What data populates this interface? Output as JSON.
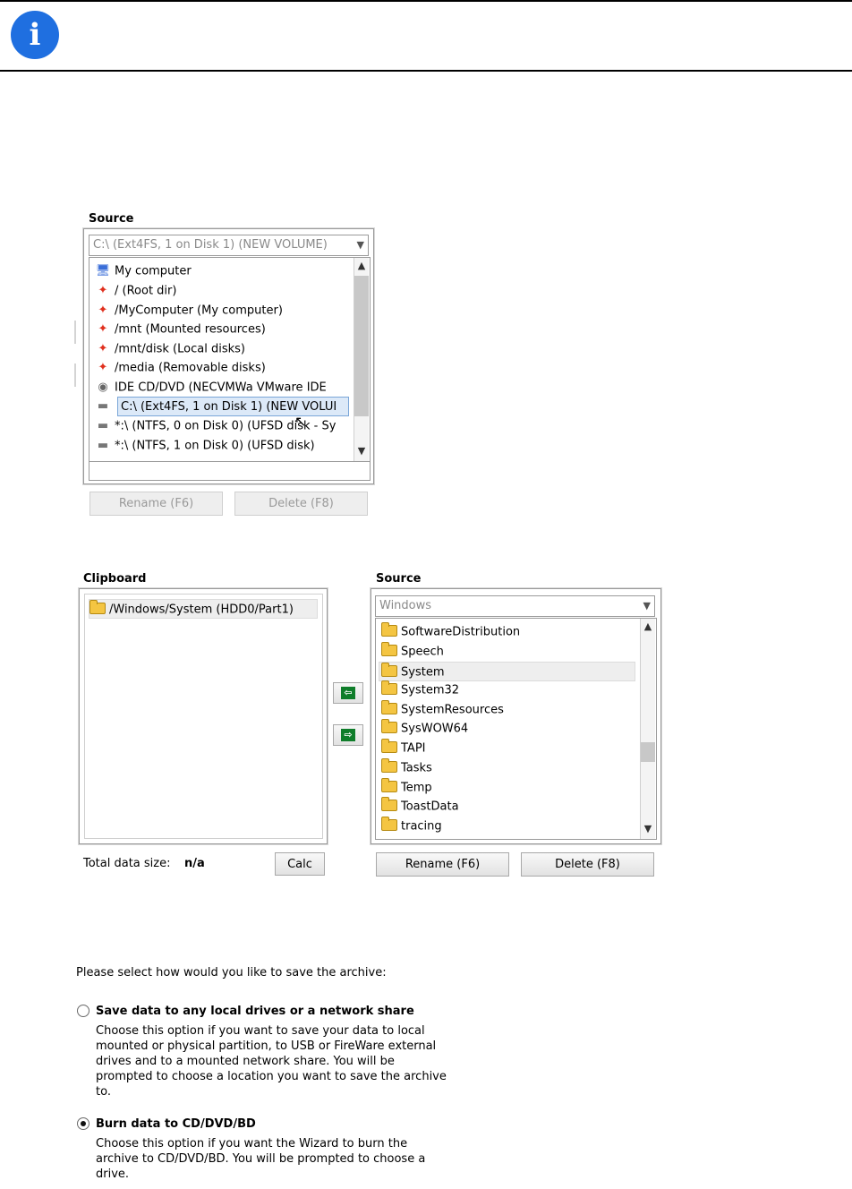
{
  "top": {
    "info_icon": "info-icon"
  },
  "source_panel_1": {
    "label": "Source",
    "combo_value": "C:\\  (Ext4FS, 1 on Disk 1) (NEW VOLUME)",
    "items": [
      {
        "icon": "computer-icon",
        "text": "My computer"
      },
      {
        "icon": "linux-icon",
        "text": "/ (Root dir)"
      },
      {
        "icon": "linux-icon",
        "text": "/MyComputer (My computer)"
      },
      {
        "icon": "linux-icon",
        "text": "/mnt (Mounted resources)"
      },
      {
        "icon": "linux-icon",
        "text": "/mnt/disk (Local disks)"
      },
      {
        "icon": "linux-icon",
        "text": "/media (Removable disks)"
      },
      {
        "icon": "cd-icon",
        "text": "IDE CD/DVD (NECVMWa VMware IDE"
      },
      {
        "icon": "drive-icon",
        "text": "C:\\  (Ext4FS, 1 on Disk 1) (NEW VOLUI"
      },
      {
        "icon": "drive-icon",
        "text": "*:\\  (NTFS, 0 on Disk 0) (UFSD disk - Sy"
      },
      {
        "icon": "drive-icon",
        "text": "*:\\  (NTFS, 1 on Disk 0) (UFSD disk)"
      }
    ],
    "rename_label": "Rename (F6)",
    "delete_label": "Delete (F8)"
  },
  "clipboard": {
    "label": "Clipboard",
    "items": [
      {
        "icon": "folder-icon",
        "text": "/Windows/System (HDD0/Part1)"
      }
    ],
    "total_label": "Total data size:",
    "total_value": "n/a",
    "calc_label": "Calc"
  },
  "source_panel_2": {
    "label": "Source",
    "combo_value": "Windows",
    "items": [
      {
        "icon": "folder-icon",
        "text": "SoftwareDistribution"
      },
      {
        "icon": "folder-icon",
        "text": "Speech"
      },
      {
        "icon": "folder-icon",
        "text": "System"
      },
      {
        "icon": "folder-icon",
        "text": "System32"
      },
      {
        "icon": "folder-icon",
        "text": "SystemResources"
      },
      {
        "icon": "folder-icon",
        "text": "SysWOW64"
      },
      {
        "icon": "folder-icon",
        "text": "TAPI"
      },
      {
        "icon": "folder-icon",
        "text": "Tasks"
      },
      {
        "icon": "folder-icon",
        "text": "Temp"
      },
      {
        "icon": "folder-icon",
        "text": "ToastData"
      },
      {
        "icon": "folder-icon",
        "text": "tracing"
      }
    ],
    "rename_label": "Rename (F6)",
    "delete_label": "Delete (F8)"
  },
  "transfer": {
    "left_icon": "arrow-left-icon",
    "right_icon": "arrow-right-icon",
    "left_glyph": "⇦",
    "right_glyph": "⇨"
  },
  "save_options": {
    "prompt": "Please select how would you like to save the archive:",
    "option1_title": "Save data to any local drives or a network share",
    "option1_desc": "Choose this option if you want to save your data to local mounted or physical partition, to USB or FireWare external drives and to a mounted network share. You will be prompted to choose a location you want to save the archive to.",
    "option2_title": "Burn data to CD/DVD/BD",
    "option2_desc": "Choose this option if you want the Wizard to burn the archive to CD/DVD/BD. You will be prompted to choose a drive.",
    "selected": "option2"
  }
}
